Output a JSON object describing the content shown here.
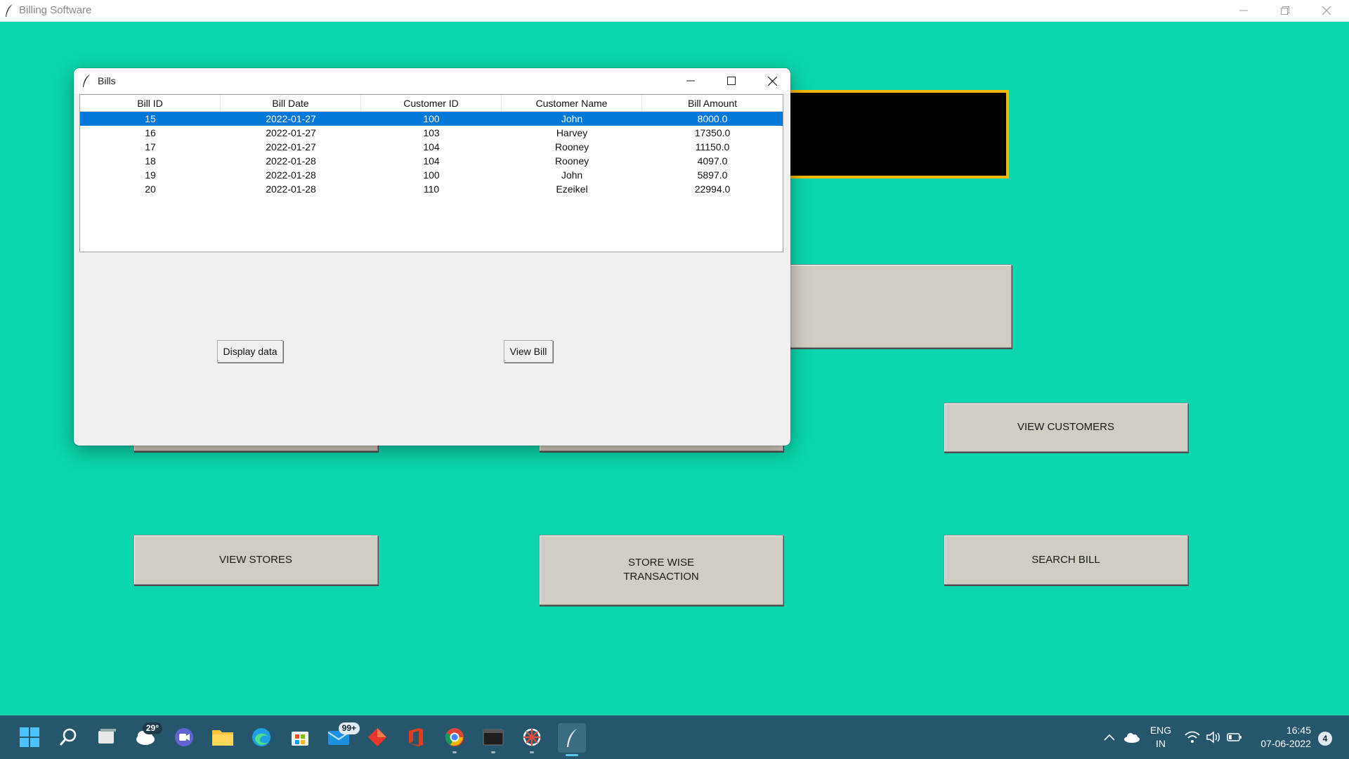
{
  "window": {
    "title": "Billing Software"
  },
  "main": {
    "buttons": {
      "view_customers": "VIEW CUSTOMERS",
      "view_stores": "VIEW STORES",
      "store_wise_line1": "STORE WISE",
      "store_wise_line2": "TRANSACTION",
      "search_bill": "SEARCH BILL"
    }
  },
  "dialog": {
    "title": "Bills",
    "table": {
      "columns": [
        "Bill ID",
        "Bill Date",
        "Customer ID",
        "Customer Name",
        "Bill Amount"
      ],
      "rows": [
        [
          "15",
          "2022-01-27",
          "100",
          "John",
          "8000.0"
        ],
        [
          "16",
          "2022-01-27",
          "103",
          "Harvey",
          "17350.0"
        ],
        [
          "17",
          "2022-01-27",
          "104",
          "Rooney",
          "11150.0"
        ],
        [
          "18",
          "2022-01-28",
          "104",
          "Rooney",
          "4097.0"
        ],
        [
          "19",
          "2022-01-28",
          "100",
          "John",
          "5897.0"
        ],
        [
          "20",
          "2022-01-28",
          "110",
          "Ezeikel",
          "22994.0"
        ]
      ],
      "selected_row": 0
    },
    "buttons": {
      "display": "Display data",
      "view_bill": "View Bill"
    }
  },
  "taskbar": {
    "weather_temp": "29°",
    "mail_badge": "99+",
    "language_line1": "ENG",
    "language_line2": "IN",
    "time": "16:45",
    "date": "07-06-2022",
    "notification_count": "4"
  },
  "colors": {
    "background": "#0bd6ad",
    "selection": "#0078d7",
    "black_box_border": "#f2b709",
    "taskbar": "#26566c"
  }
}
